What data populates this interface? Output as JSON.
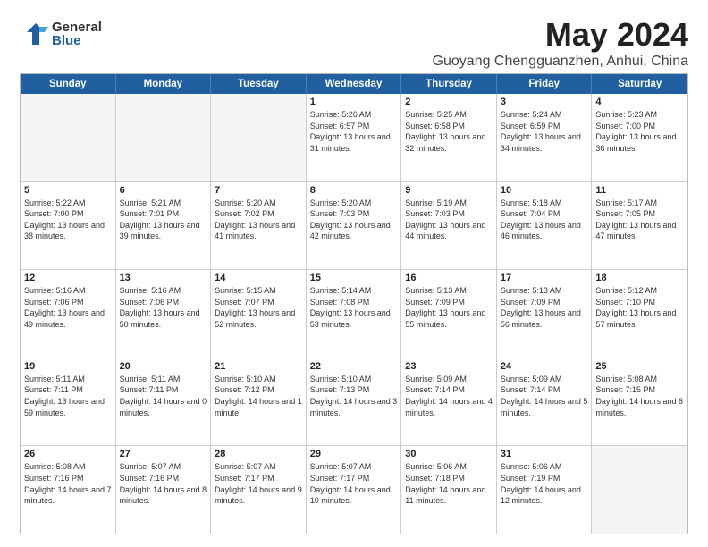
{
  "logo": {
    "general": "General",
    "blue": "Blue"
  },
  "title": "May 2024",
  "subtitle": "Guoyang Chengguanzhen, Anhui, China",
  "header_days": [
    "Sunday",
    "Monday",
    "Tuesday",
    "Wednesday",
    "Thursday",
    "Friday",
    "Saturday"
  ],
  "weeks": [
    [
      {
        "num": "",
        "sunrise": "",
        "sunset": "",
        "daylight": "",
        "empty": true
      },
      {
        "num": "",
        "sunrise": "",
        "sunset": "",
        "daylight": "",
        "empty": true
      },
      {
        "num": "",
        "sunrise": "",
        "sunset": "",
        "daylight": "",
        "empty": true
      },
      {
        "num": "1",
        "sunrise": "Sunrise: 5:26 AM",
        "sunset": "Sunset: 6:57 PM",
        "daylight": "Daylight: 13 hours and 31 minutes."
      },
      {
        "num": "2",
        "sunrise": "Sunrise: 5:25 AM",
        "sunset": "Sunset: 6:58 PM",
        "daylight": "Daylight: 13 hours and 32 minutes."
      },
      {
        "num": "3",
        "sunrise": "Sunrise: 5:24 AM",
        "sunset": "Sunset: 6:59 PM",
        "daylight": "Daylight: 13 hours and 34 minutes."
      },
      {
        "num": "4",
        "sunrise": "Sunrise: 5:23 AM",
        "sunset": "Sunset: 7:00 PM",
        "daylight": "Daylight: 13 hours and 36 minutes."
      }
    ],
    [
      {
        "num": "5",
        "sunrise": "Sunrise: 5:22 AM",
        "sunset": "Sunset: 7:00 PM",
        "daylight": "Daylight: 13 hours and 38 minutes."
      },
      {
        "num": "6",
        "sunrise": "Sunrise: 5:21 AM",
        "sunset": "Sunset: 7:01 PM",
        "daylight": "Daylight: 13 hours and 39 minutes."
      },
      {
        "num": "7",
        "sunrise": "Sunrise: 5:20 AM",
        "sunset": "Sunset: 7:02 PM",
        "daylight": "Daylight: 13 hours and 41 minutes."
      },
      {
        "num": "8",
        "sunrise": "Sunrise: 5:20 AM",
        "sunset": "Sunset: 7:03 PM",
        "daylight": "Daylight: 13 hours and 42 minutes."
      },
      {
        "num": "9",
        "sunrise": "Sunrise: 5:19 AM",
        "sunset": "Sunset: 7:03 PM",
        "daylight": "Daylight: 13 hours and 44 minutes."
      },
      {
        "num": "10",
        "sunrise": "Sunrise: 5:18 AM",
        "sunset": "Sunset: 7:04 PM",
        "daylight": "Daylight: 13 hours and 46 minutes."
      },
      {
        "num": "11",
        "sunrise": "Sunrise: 5:17 AM",
        "sunset": "Sunset: 7:05 PM",
        "daylight": "Daylight: 13 hours and 47 minutes."
      }
    ],
    [
      {
        "num": "12",
        "sunrise": "Sunrise: 5:16 AM",
        "sunset": "Sunset: 7:06 PM",
        "daylight": "Daylight: 13 hours and 49 minutes."
      },
      {
        "num": "13",
        "sunrise": "Sunrise: 5:16 AM",
        "sunset": "Sunset: 7:06 PM",
        "daylight": "Daylight: 13 hours and 50 minutes."
      },
      {
        "num": "14",
        "sunrise": "Sunrise: 5:15 AM",
        "sunset": "Sunset: 7:07 PM",
        "daylight": "Daylight: 13 hours and 52 minutes."
      },
      {
        "num": "15",
        "sunrise": "Sunrise: 5:14 AM",
        "sunset": "Sunset: 7:08 PM",
        "daylight": "Daylight: 13 hours and 53 minutes."
      },
      {
        "num": "16",
        "sunrise": "Sunrise: 5:13 AM",
        "sunset": "Sunset: 7:09 PM",
        "daylight": "Daylight: 13 hours and 55 minutes."
      },
      {
        "num": "17",
        "sunrise": "Sunrise: 5:13 AM",
        "sunset": "Sunset: 7:09 PM",
        "daylight": "Daylight: 13 hours and 56 minutes."
      },
      {
        "num": "18",
        "sunrise": "Sunrise: 5:12 AM",
        "sunset": "Sunset: 7:10 PM",
        "daylight": "Daylight: 13 hours and 57 minutes."
      }
    ],
    [
      {
        "num": "19",
        "sunrise": "Sunrise: 5:11 AM",
        "sunset": "Sunset: 7:11 PM",
        "daylight": "Daylight: 13 hours and 59 minutes."
      },
      {
        "num": "20",
        "sunrise": "Sunrise: 5:11 AM",
        "sunset": "Sunset: 7:11 PM",
        "daylight": "Daylight: 14 hours and 0 minutes."
      },
      {
        "num": "21",
        "sunrise": "Sunrise: 5:10 AM",
        "sunset": "Sunset: 7:12 PM",
        "daylight": "Daylight: 14 hours and 1 minute."
      },
      {
        "num": "22",
        "sunrise": "Sunrise: 5:10 AM",
        "sunset": "Sunset: 7:13 PM",
        "daylight": "Daylight: 14 hours and 3 minutes."
      },
      {
        "num": "23",
        "sunrise": "Sunrise: 5:09 AM",
        "sunset": "Sunset: 7:14 PM",
        "daylight": "Daylight: 14 hours and 4 minutes."
      },
      {
        "num": "24",
        "sunrise": "Sunrise: 5:09 AM",
        "sunset": "Sunset: 7:14 PM",
        "daylight": "Daylight: 14 hours and 5 minutes."
      },
      {
        "num": "25",
        "sunrise": "Sunrise: 5:08 AM",
        "sunset": "Sunset: 7:15 PM",
        "daylight": "Daylight: 14 hours and 6 minutes."
      }
    ],
    [
      {
        "num": "26",
        "sunrise": "Sunrise: 5:08 AM",
        "sunset": "Sunset: 7:16 PM",
        "daylight": "Daylight: 14 hours and 7 minutes."
      },
      {
        "num": "27",
        "sunrise": "Sunrise: 5:07 AM",
        "sunset": "Sunset: 7:16 PM",
        "daylight": "Daylight: 14 hours and 8 minutes."
      },
      {
        "num": "28",
        "sunrise": "Sunrise: 5:07 AM",
        "sunset": "Sunset: 7:17 PM",
        "daylight": "Daylight: 14 hours and 9 minutes."
      },
      {
        "num": "29",
        "sunrise": "Sunrise: 5:07 AM",
        "sunset": "Sunset: 7:17 PM",
        "daylight": "Daylight: 14 hours and 10 minutes."
      },
      {
        "num": "30",
        "sunrise": "Sunrise: 5:06 AM",
        "sunset": "Sunset: 7:18 PM",
        "daylight": "Daylight: 14 hours and 11 minutes."
      },
      {
        "num": "31",
        "sunrise": "Sunrise: 5:06 AM",
        "sunset": "Sunset: 7:19 PM",
        "daylight": "Daylight: 14 hours and 12 minutes."
      },
      {
        "num": "",
        "sunrise": "",
        "sunset": "",
        "daylight": "",
        "empty": true
      }
    ]
  ]
}
